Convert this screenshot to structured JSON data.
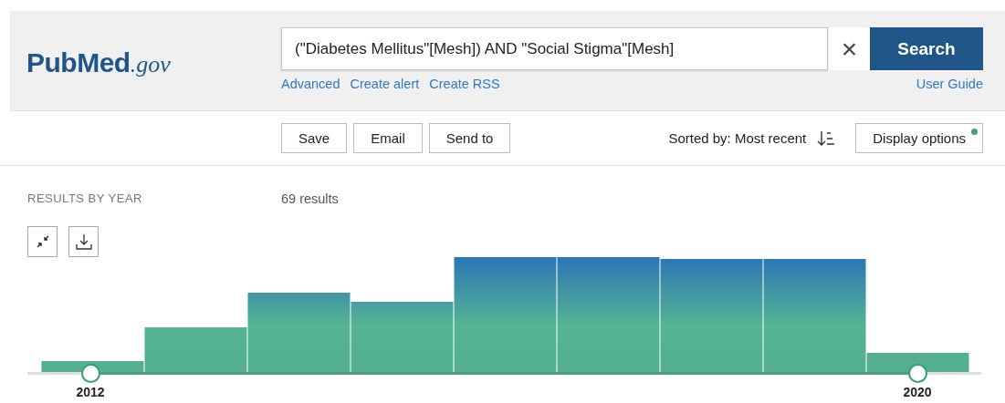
{
  "logo": {
    "name": "PubMed",
    "suffix": ".gov"
  },
  "search": {
    "value": "(\"Diabetes Mellitus\"[Mesh]) AND \"Social Stigma\"[Mesh]",
    "clear": "×",
    "button": "Search"
  },
  "links": [
    "Advanced",
    "Create alert",
    "Create RSS"
  ],
  "user_guide": "User Guide",
  "actions": [
    "Save",
    "Email",
    "Send to"
  ],
  "sort": {
    "label": "Sorted by: Most recent"
  },
  "display_options": {
    "label": "Display options",
    "changed": true
  },
  "results_by_year": {
    "title": "RESULTS BY YEAR",
    "count": "69 results",
    "range": [
      {
        "label": "2012",
        "level": 0.066
      },
      {
        "label": "2020",
        "level": 0.933
      }
    ]
  }
}
